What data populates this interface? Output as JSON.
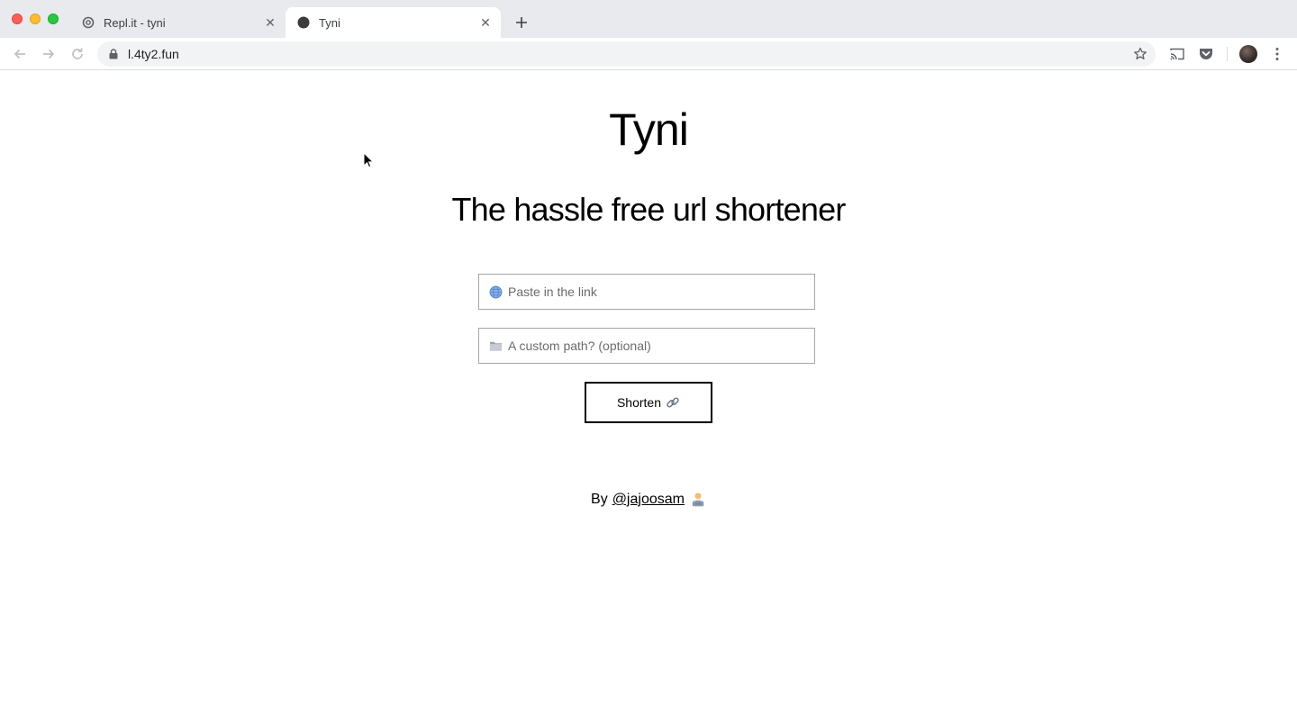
{
  "browser": {
    "tabs": [
      {
        "title": "Repl.it - tyni",
        "favicon": "replit-icon",
        "active": false
      },
      {
        "title": "Tyni",
        "favicon": "circle-icon",
        "active": true
      }
    ],
    "address": {
      "url": "l.4ty2.fun"
    },
    "toolbar_icons": [
      "back-arrow-icon",
      "forward-arrow-icon",
      "reload-icon",
      "lock-icon",
      "star-icon",
      "cast-icon",
      "pocket-icon",
      "avatar",
      "kebab-menu-icon"
    ]
  },
  "page": {
    "title": "Tyni",
    "tagline": "The hassle free url shortener",
    "link_input": {
      "placeholder": "Paste in the link",
      "icon": "globe-icon",
      "value": ""
    },
    "path_input": {
      "placeholder": "A custom path? (optional)",
      "icon": "folder-icon",
      "value": ""
    },
    "shorten_button": {
      "label": "Shorten",
      "icon": "link-icon"
    },
    "footer": {
      "prefix": "By",
      "author_handle": "@jajoosam",
      "icon": "technologist-icon"
    }
  },
  "colors": {
    "tabstrip": "#e8eaed",
    "omnibox": "#f1f3f4",
    "text": "#000000",
    "input_border": "#a6a6a6"
  }
}
